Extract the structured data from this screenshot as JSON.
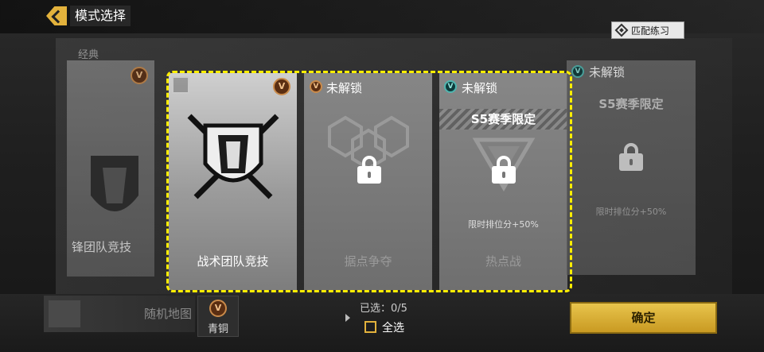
{
  "header": {
    "title": "模式选择",
    "practice_button": "匹配练习"
  },
  "background": {
    "faint_top_left": "经典"
  },
  "cards": [
    {
      "id": "left-partial",
      "title": "锋团队竞技",
      "locked": false
    },
    {
      "id": "tactical-tdm",
      "title": "战术团队竞技",
      "locked": false,
      "selected": true
    },
    {
      "id": "domination",
      "title": "据点争夺",
      "lock_label": "未解锁",
      "locked": true
    },
    {
      "id": "hardpoint",
      "title": "热点战",
      "lock_label": "未解锁",
      "locked": true,
      "season_banner": "S5赛季限定",
      "bonus": "限时排位分+50%"
    },
    {
      "id": "right-partial",
      "title": "",
      "lock_label": "未解锁",
      "locked": true,
      "season_banner": "S5赛季限定",
      "bonus": "限时排位分+50%"
    }
  ],
  "bottom": {
    "random_map": "随机地图",
    "rank_label": "青铜",
    "selected_count": "已选：0/5",
    "select_all": "全选",
    "confirm": "确定"
  },
  "colors": {
    "highlight_frame": "#ffee00",
    "confirm_button": "#e3b23c",
    "rank_badge": "#c98a4a",
    "season_badge": "#4fb6b0"
  }
}
